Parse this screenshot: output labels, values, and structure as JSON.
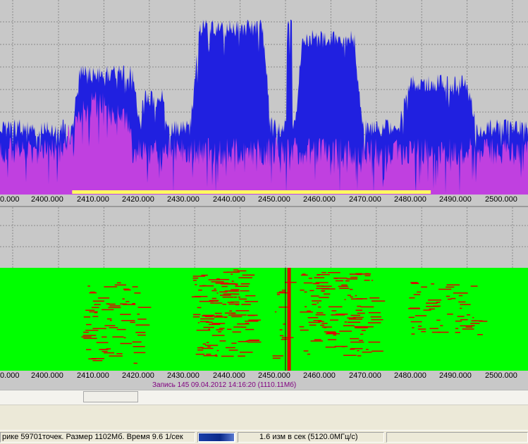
{
  "axis_ticks": [
    "2400.000",
    "2410.000",
    "2420.000",
    "2430.000",
    "2440.000",
    "2450.000",
    "2460.000",
    "2470.000",
    "2480.000",
    "2490.000",
    "2500.000"
  ],
  "axis_start": "0.000",
  "axis_start_2": "0.000",
  "record_label": "Запись 145 09.04.2012 14:16:20 (1110.11Мб)",
  "status": {
    "info": "рике 59701точек. Размер 1102Мб. Время 9.6 1/сек",
    "progress": 1.0,
    "rate": "1.6 изм в сек (5120.0МГц/с)"
  },
  "colors": {
    "peak_trace": "#2020e0",
    "avg_trace": "#c040e0",
    "waterfall_bg": "#00ff00",
    "waterfall_marks": "#e00000",
    "selection_bar": "#ffff60",
    "grid_bg": "#c8c8c8"
  },
  "chart_data": {
    "type": "area",
    "x_range": [
      2390,
      2505
    ],
    "selection_range": [
      2403,
      2482
    ],
    "series": [
      {
        "values_envelope": "peak"
      },
      {
        "values_envelope": "average"
      }
    ]
  }
}
